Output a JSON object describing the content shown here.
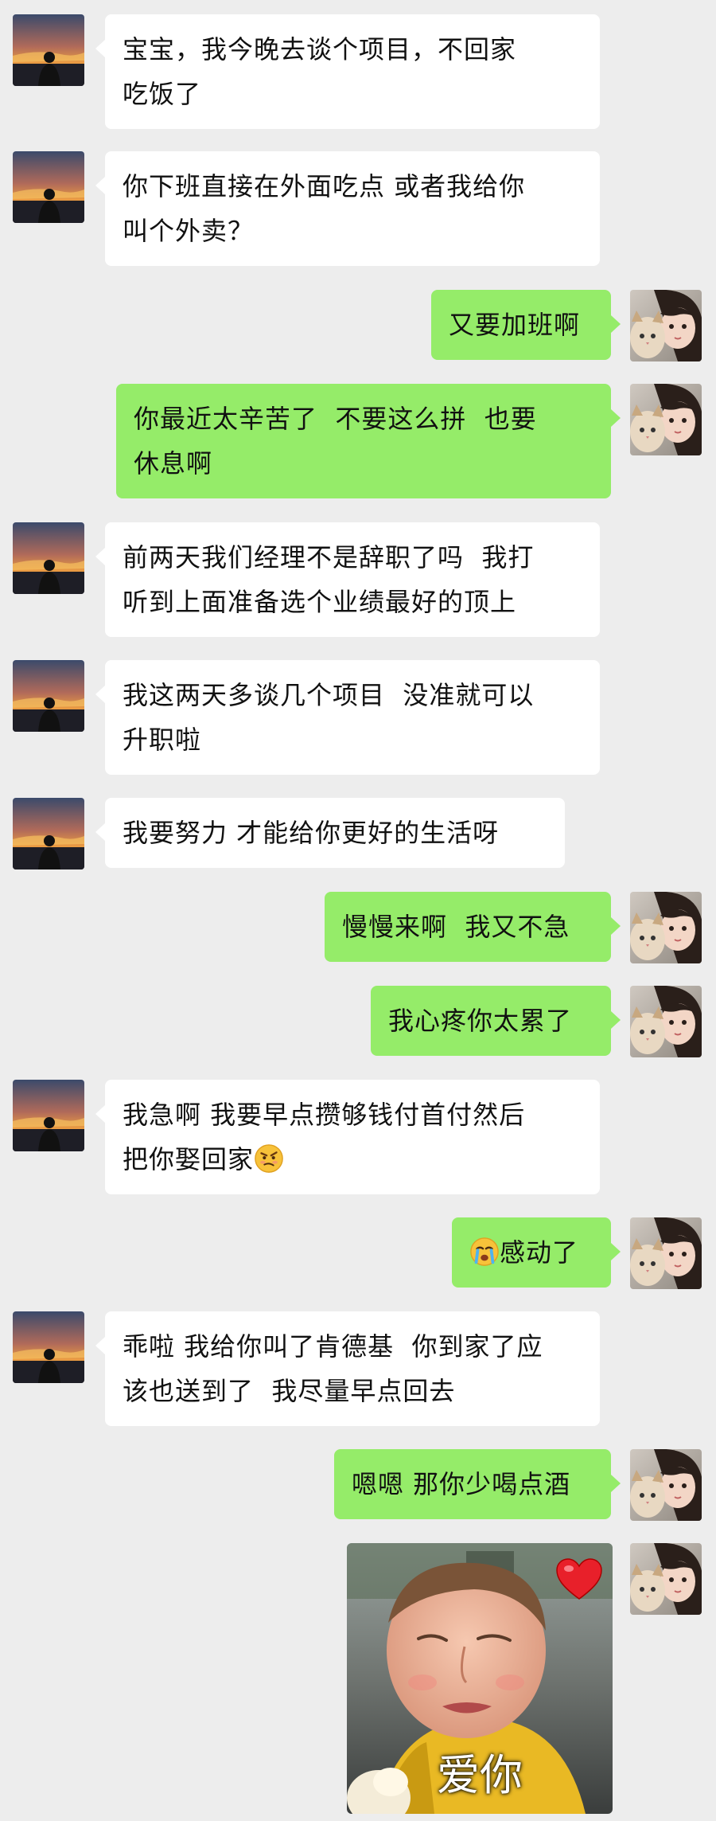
{
  "conversation": {
    "messages": [
      {
        "from": "contact",
        "text": "宝宝，我今晚去谈个项目，不回家\n吃饭了"
      },
      {
        "from": "contact",
        "text": "你下班直接在外面吃点 或者我给你\n叫个外卖？"
      },
      {
        "from": "me",
        "text": "又要加班啊"
      },
      {
        "from": "me",
        "text": "你最近太辛苦了  不要这么拼  也要\n休息啊"
      },
      {
        "from": "contact",
        "text": "前两天我们经理不是辞职了吗  我打\n听到上面准备选个业绩最好的顶上"
      },
      {
        "from": "contact",
        "text": "我这两天多谈几个项目  没准就可以\n升职啦"
      },
      {
        "from": "contact",
        "text": "我要努力 才能给你更好的生活呀"
      },
      {
        "from": "me",
        "text": "慢慢来啊  我又不急"
      },
      {
        "from": "me",
        "text": "我心疼你太累了"
      },
      {
        "from": "contact",
        "text": "我急啊 我要早点攒够钱付首付然后\n把你娶回家",
        "emoji_after": "thinking-face-emoji"
      },
      {
        "from": "me",
        "text": "感动了",
        "emoji_before": "crying-face-emoji"
      },
      {
        "from": "contact",
        "text": "乖啦 我给你叫了肯德基  你到家了应\n该也送到了  我尽量早点回去"
      },
      {
        "from": "me",
        "text": "嗯嗯 那你少喝点酒"
      }
    ],
    "sticker": {
      "from": "me",
      "caption": "爱你",
      "icon": "heart-icon"
    }
  },
  "colors": {
    "background": "#ededed",
    "incoming_bubble": "#ffffff",
    "outgoing_bubble": "#95ec69"
  }
}
